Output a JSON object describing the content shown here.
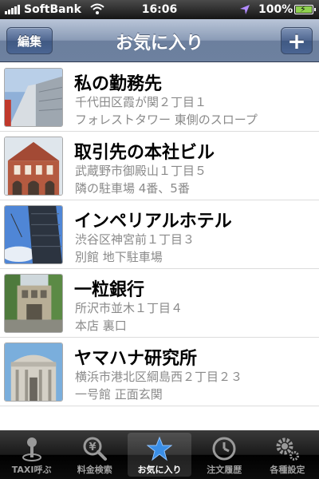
{
  "status_bar": {
    "carrier": "SoftBank",
    "time": "16:06",
    "battery": "100%"
  },
  "nav": {
    "title": "お気に入り",
    "edit_label": "編集",
    "add_label": "+"
  },
  "favorites": [
    {
      "title": "私の勤務先",
      "line1": "千代田区霞が関２丁目１",
      "line2": "フォレストタワー 東側のスロープ"
    },
    {
      "title": "取引先の本社ビル",
      "line1": "武蔵野市御殿山１丁目５",
      "line2": "隣の駐車場 4番、5番"
    },
    {
      "title": "インペリアルホテル",
      "line1": "渋谷区神宮前１丁目３",
      "line2": "別館 地下駐車場"
    },
    {
      "title": "一粒銀行",
      "line1": "所沢市並木１丁目４",
      "line2": "本店 裏口"
    },
    {
      "title": "ヤマハナ研究所",
      "line1": "横浜市港北区綱島西２丁目２３",
      "line2": "一号館 正面玄関"
    }
  ],
  "tab_bar": {
    "tabs": [
      {
        "label": "TAXI呼ぶ",
        "icon": "taxi-pin-icon"
      },
      {
        "label": "料金検索",
        "icon": "yen-search-icon"
      },
      {
        "label": "お気に入り",
        "icon": "star-icon"
      },
      {
        "label": "注文履歴",
        "icon": "clock-icon"
      },
      {
        "label": "各種設定",
        "icon": "gear-icon"
      }
    ],
    "active_index": 2
  },
  "colors": {
    "nav_bar": "#7d8fad",
    "active_star": "#3a8ee6",
    "subtitle_text": "#8a8a8a"
  }
}
